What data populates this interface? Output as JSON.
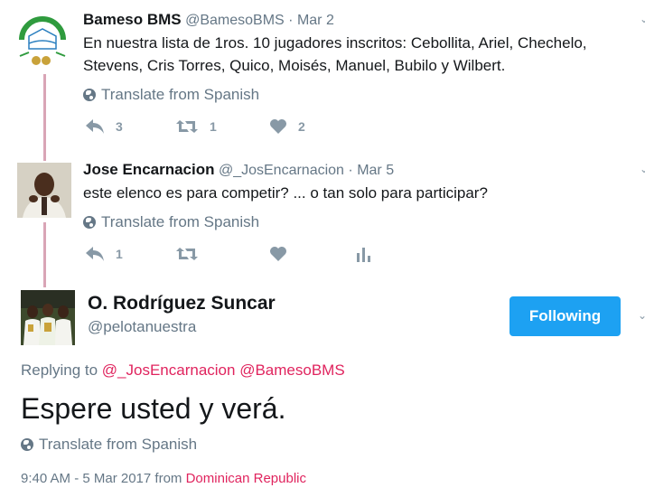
{
  "tweet1": {
    "name": "Bameso BMS",
    "handle": "@BamesoBMS",
    "date": "Mar 2",
    "text_line1": "En nuestra lista de 1ros. 10 jugadores inscritos: Cebollita, Ariel, Chechelo,",
    "text_line2": "Stevens, Cris Torres, Quico, Moisés, Manuel, Bubilo y Wilbert.",
    "translate": "Translate from Spanish",
    "reply_count": "3",
    "retweet_count": "1",
    "like_count": "2",
    "avatar_text": "CLUB BAMESO"
  },
  "tweet2": {
    "name": "Jose Encarnacion",
    "handle": "@_JosEncarnacion",
    "date": "Mar 5",
    "text": "este elenco es para competir? ... o tan solo para participar?",
    "translate": "Translate from Spanish",
    "reply_count": "1"
  },
  "main": {
    "name": "O. Rodríguez Suncar",
    "handle": "@pelotanuestra",
    "follow_label": "Following",
    "replying_prefix": "Replying to",
    "replying_to_1": "@_JosEncarnacion",
    "replying_to_2": "@BamesoBMS",
    "text": "Espere usted y verá.",
    "translate": "Translate from Spanish",
    "timestamp": "9:40 AM - 5 Mar 2017 from",
    "location": "Dominican Republic"
  },
  "sep": "·",
  "icons": [
    "reply-icon",
    "retweet-icon",
    "like-icon",
    "analytics-icon",
    "globe-icon",
    "caret-down-icon"
  ],
  "colors": {
    "accent": "#1da1f2",
    "link": "#e0245e",
    "thread": "#d9a5b6"
  }
}
